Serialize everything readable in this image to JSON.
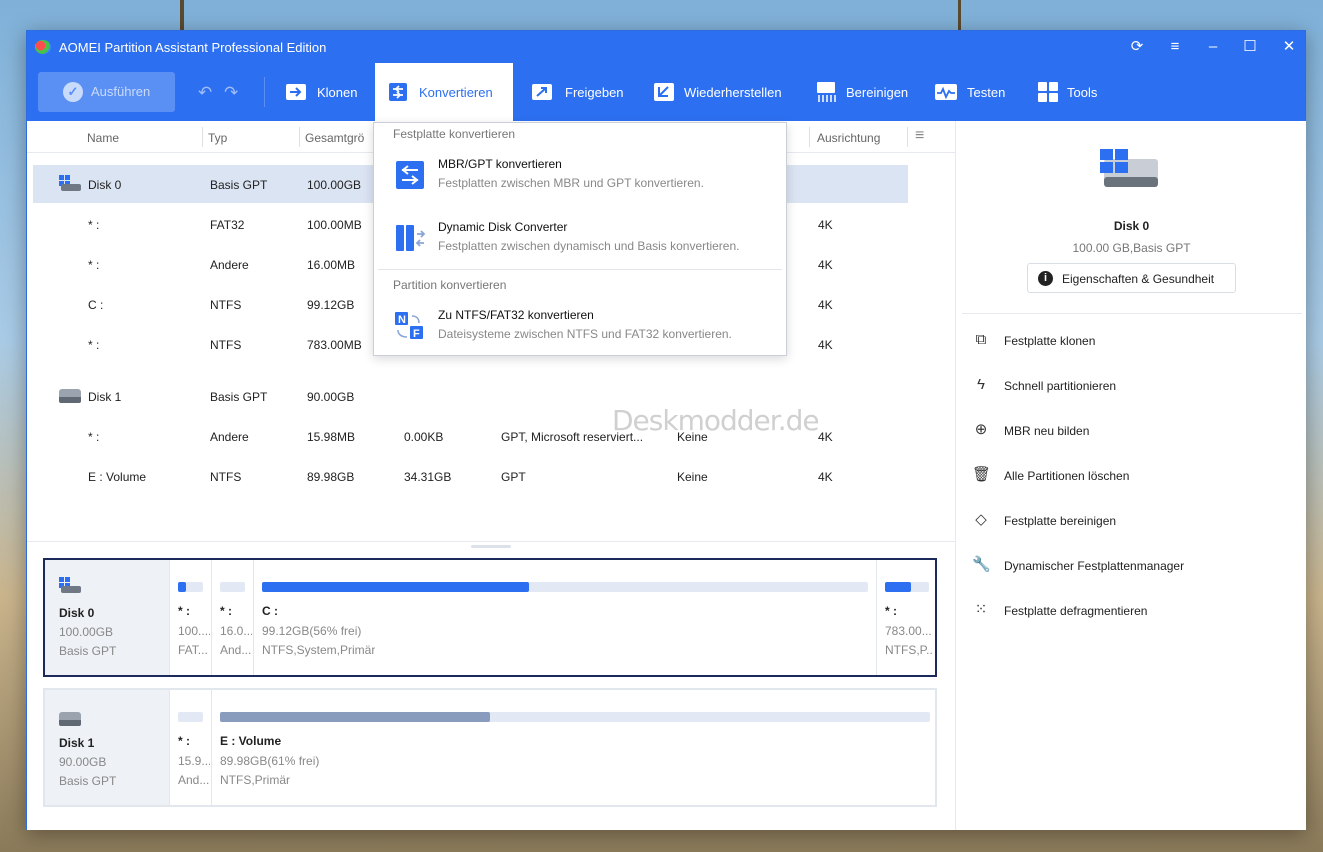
{
  "window": {
    "title": "AOMEI Partition Assistant Professional Edition"
  },
  "toolbar": {
    "run_label": "Ausführen",
    "items": [
      {
        "label": "Klonen",
        "icon": "clone-icon"
      },
      {
        "label": "Konvertieren",
        "icon": "convert-icon"
      },
      {
        "label": "Freigeben",
        "icon": "share-icon"
      },
      {
        "label": "Wiederherstellen",
        "icon": "restore-icon"
      },
      {
        "label": "Bereinigen",
        "icon": "wipe-icon"
      },
      {
        "label": "Testen",
        "icon": "test-icon"
      },
      {
        "label": "Tools",
        "icon": "tools-icon"
      }
    ]
  },
  "table": {
    "columns": [
      "Name",
      "Typ",
      "Gesamtgrö",
      "Ausrichtung"
    ],
    "rows": [
      {
        "name": "Disk 0",
        "type": "Basis GPT",
        "size": "100.00GB",
        "used": "",
        "fs2": "",
        "flag": "",
        "align": ""
      },
      {
        "name": "* :",
        "type": "FAT32",
        "size": "100.00MB",
        "used": "",
        "fs2": "",
        "flag": "",
        "align": "4K"
      },
      {
        "name": "* :",
        "type": "Andere",
        "size": "16.00MB",
        "used": "",
        "fs2": "",
        "flag": "",
        "align": "4K"
      },
      {
        "name": "C :",
        "type": "NTFS",
        "size": "99.12GB",
        "used": "",
        "fs2": "",
        "flag": "",
        "align": "4K"
      },
      {
        "name": "* :",
        "type": "NTFS",
        "size": "783.00MB",
        "used": "",
        "fs2": "",
        "flag": "",
        "align": "4K"
      },
      {
        "name": "Disk 1",
        "type": "Basis GPT",
        "size": "90.00GB",
        "used": "",
        "fs2": "",
        "flag": "",
        "align": ""
      },
      {
        "name": "* :",
        "type": "Andere",
        "size": "15.98MB",
        "used": "0.00KB",
        "fs2": "GPT, Microsoft reserviert...",
        "flag": "Keine",
        "align": "4K"
      },
      {
        "name": "E : Volume",
        "type": "NTFS",
        "size": "89.98GB",
        "used": "34.31GB",
        "fs2": "GPT",
        "flag": "Keine",
        "align": "4K"
      }
    ]
  },
  "dropdown": {
    "section1": "Festplatte konvertieren",
    "item1_title": "MBR/GPT konvertieren",
    "item1_desc": "Festplatten zwischen MBR und GPT konvertieren.",
    "item2_title": "Dynamic Disk Converter",
    "item2_desc": "Festplatten zwischen dynamisch und Basis konvertieren.",
    "section2": "Partition konvertieren",
    "item3_title": "Zu NTFS/FAT32 konvertieren",
    "item3_desc": "Dateisysteme zwischen NTFS und FAT32 konvertieren."
  },
  "watermark": "Deskmodder.de",
  "diskmap": {
    "disk0": {
      "name": "Disk 0",
      "size": "100.00GB",
      "type": "Basis GPT",
      "parts": [
        {
          "name": "* :",
          "a": "100....",
          "b": "FAT...",
          "usage": 0.3
        },
        {
          "name": "* :",
          "a": "16.0...",
          "b": "And...",
          "usage": 0.0
        },
        {
          "name": "C :",
          "a": "99.12GB(56% frei)",
          "b": "NTFS,System,Primär",
          "usage": 0.44
        },
        {
          "name": "* :",
          "a": "783.00...",
          "b": "NTFS,P...",
          "usage": 0.6
        }
      ]
    },
    "disk1": {
      "name": "Disk 1",
      "size": "90.00GB",
      "type": "Basis GPT",
      "parts": [
        {
          "name": "* :",
          "a": "15.9...",
          "b": "And...",
          "usage": 0.0
        },
        {
          "name": "E : Volume",
          "a": "89.98GB(61% frei)",
          "b": "NTFS,Primär",
          "usage": 0.38
        }
      ]
    }
  },
  "right": {
    "disk_name": "Disk 0",
    "disk_sub": "100.00 GB,Basis GPT",
    "props_btn": "Eigenschaften & Gesundheit",
    "actions": [
      {
        "label": "Festplatte klonen",
        "icon": "clone-disk-icon"
      },
      {
        "label": "Schnell partitionieren",
        "icon": "lightning-icon"
      },
      {
        "label": "MBR neu bilden",
        "icon": "rebuild-icon"
      },
      {
        "label": "Alle Partitionen löschen",
        "icon": "trash-icon"
      },
      {
        "label": "Festplatte bereinigen",
        "icon": "eraser-icon"
      },
      {
        "label": "Dynamischer Festplattenmanager",
        "icon": "wrench-icon"
      },
      {
        "label": "Festplatte defragmentieren",
        "icon": "defrag-icon"
      }
    ]
  },
  "colors": {
    "accent": "#2c6ff0",
    "selection": "#dbe4f3"
  }
}
